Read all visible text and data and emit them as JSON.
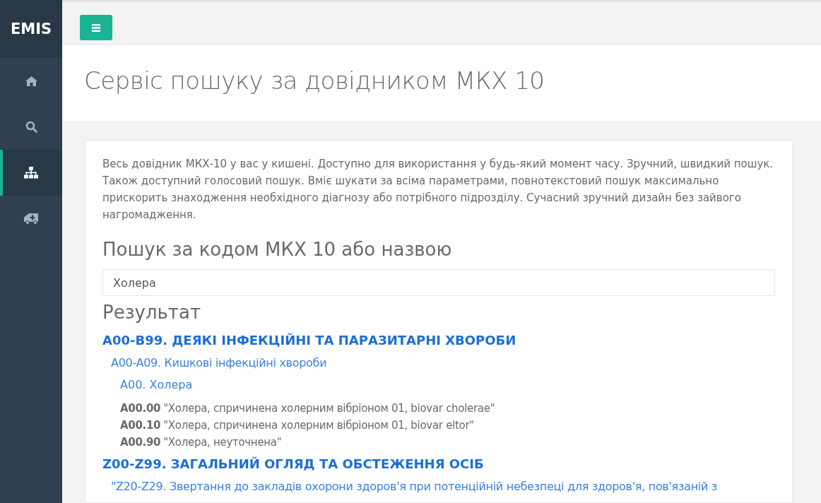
{
  "sidebar": {
    "logo": "EMIS",
    "items": [
      {
        "selected": false
      },
      {
        "selected": false
      },
      {
        "selected": true
      },
      {
        "selected": false
      }
    ]
  },
  "page_title": "Сервіс пошуку за довідником МКХ 10",
  "description": "Весь довідник МКХ-10 у вас у кишені. Доступно для використання у будь-який момент часу. Зручний, швидкий пошук. Також доступний голосовий пошук. Вміє шукати за всіма параметрами, повнотекстовий пошук максимально прискорить знаходження необхідного діагнозу або потрібного підрозділу. Сучасний зручний дизайн без зайвого нагромадження.",
  "search": {
    "heading": "Пошук за кодом МКХ 10 або назвою",
    "value": "Холера"
  },
  "results": {
    "heading": "Результат",
    "children": [
      {
        "kind": "chapter",
        "label": "A00-B99. ДЕЯКІ ІНФЕКЦІЙНІ ТА ПАРАЗИТАРНІ ХВОРОБИ",
        "children": [
          {
            "kind": "block",
            "label": "A00-A09. Кишкові інфекційні хвороби",
            "children": [
              {
                "kind": "category",
                "label": "A00. Холера",
                "children": [
                  {
                    "kind": "code",
                    "code": "A00.00",
                    "label": "\"Холера, спричинена холерним вібріоном 01, biovar cholerae\""
                  },
                  {
                    "kind": "code",
                    "code": "A00.10",
                    "label": "\"Холера, спричинена холерним вібріоном 01, biovar eltor\""
                  },
                  {
                    "kind": "code",
                    "code": "A00.90",
                    "label": "\"Холера, неуточнена\""
                  }
                ]
              }
            ]
          }
        ]
      },
      {
        "kind": "chapter",
        "label": "Z00-Z99. ЗАГАЛЬНИЙ ОГЛЯД ТА ОБСТЕЖЕННЯ ОСІБ",
        "children": [
          {
            "kind": "block",
            "label": "\"Z20-Z29. Звертання до закладів охорони здоров'я при потенційній небезпеці для здоров'я, пов'язаній з"
          }
        ]
      }
    ]
  }
}
